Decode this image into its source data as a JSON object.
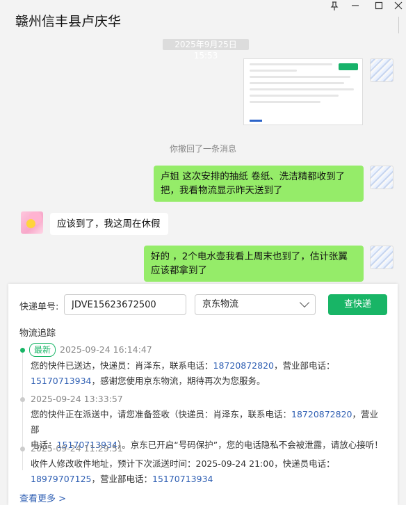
{
  "window": {
    "title": "赣州信丰县卢庆华"
  },
  "icons": {
    "pin": "pin-icon",
    "minimize": "minimize-icon",
    "maximize": "maximize-icon",
    "close": "close-icon",
    "dropdown": "chevron-down-icon"
  },
  "chat": {
    "timestamp": "2025年9月25日 15:53",
    "recall_notice": "你撤回了一条消息",
    "messages": [
      {
        "sender": "me",
        "text": "卢姐   这次安排的抽纸 卷纸、洗洁精都收到了把，我看物流显示昨天送到了"
      },
      {
        "sender": "friend",
        "text": "应该到了，我这周在休假"
      },
      {
        "sender": "me",
        "text": "好的   ，2个电水壶我看上周末也到了，估计张翼应该都拿到了"
      }
    ]
  },
  "tracking": {
    "label": "快递单号:",
    "tracking_number": "JDVE15623672500",
    "carrier": "京东物流",
    "query_button": "查快递",
    "section_title": "物流追踪",
    "latest_badge": "最新",
    "events": [
      {
        "time": "2025-09-24 16:14:47",
        "line1_prefix": "您的快件已送达，快递员：肖泽东，联系电话：",
        "phone1": "18720872820",
        "line1_suffix": "，营业部电话：",
        "phone2": "15170713934",
        "line2_suffix": "，感谢您使用京东物流，期待再次为您服务。"
      },
      {
        "time": "2025-09-24 13:33:57",
        "line1_prefix": "您的快件正在派送中，请您准备签收（快递员：肖泽东，联系电话：",
        "phone1": "18720872820",
        "line1_suffix": "，营业部",
        "line2_prefix": "电话：",
        "phone2": "15170713934",
        "line2_suffix": "）。京东已开启“号码保护”，您的电话隐私不会被泄露，请放心接听！"
      },
      {
        "time": "2025-09-24 11:29:51",
        "line1": "收件人修改收件地址，预计下次派送时间：2025-09-24 21:00，快递员电话：",
        "phone1": "18979707125",
        "line2_suffix": "，营业部电话：",
        "phone2": "15170713934"
      }
    ],
    "more": "查看更多 >"
  }
}
